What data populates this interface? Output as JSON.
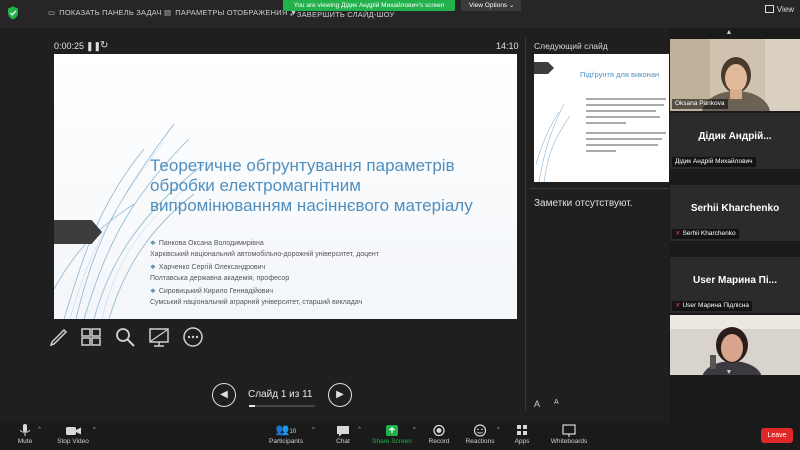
{
  "top_bar": {
    "taskbar_label": "ПОКАЗАТЬ ПАНЕЛЬ ЗАДАЧ",
    "display_settings_label": "ПАРАМЕТРЫ ОТОБРАЖЕНИЯ ▼",
    "end_show_label": "ЗАВЕРШИТЬ СЛАЙД-ШОУ",
    "viewing_banner": "You are viewing Дідик Андрій Михайлович's screen",
    "view_options_label": "View Options ⌄",
    "view_label": "View"
  },
  "presenter": {
    "elapsed": "0:00:25",
    "clock": "14:10",
    "slide_counter": "Слайд 1 из 11",
    "slide_index": 1,
    "slide_total": 11
  },
  "slide": {
    "title": "Теоретичне обгрунтування параметрів обробки електромагнітним випромінюванням насіннєвого матеріалу",
    "lines": [
      "Панкова Оксана Володимирівна",
      "Харківський національний автомобільно-дорожній університет, доцент",
      "Харченко Сергій Олександрович",
      "Полтавська державна академія, професор",
      "Сировицький Кирило Геннадійович",
      "Сумський національний аграрний університет, старший викладач"
    ],
    "bullet_rows": [
      0,
      2,
      4
    ]
  },
  "next_slide": {
    "label": "Следующий слайд",
    "title": "Підґрунтя для виконан"
  },
  "notes": {
    "text": "Заметки отсутствуют.",
    "font_large": "A",
    "font_small": "A"
  },
  "participants": [
    {
      "label": "Oksana Pankova",
      "big_name": "",
      "video": true,
      "muted": false
    },
    {
      "label": "Дідик Андрій Михайлович",
      "big_name": "Дідик Андрій...",
      "video": false,
      "muted": false
    },
    {
      "label": "Serhii Kharchenko",
      "big_name": "Serhii Kharchenko",
      "video": false,
      "muted": true
    },
    {
      "label": "User Марина Підлісна",
      "big_name": "User Марина Пі...",
      "video": false,
      "muted": true
    },
    {
      "label": "",
      "big_name": "",
      "video": true,
      "muted": false
    }
  ],
  "toolbar": {
    "mute": "Mute",
    "stop_video": "Stop Video",
    "participants": "Participants",
    "participants_count": "10",
    "chat": "Chat",
    "share_screen": "Share Screen",
    "record": "Record",
    "reactions": "Reactions",
    "apps": "Apps",
    "whiteboards": "Whiteboards",
    "leave": "Leave"
  },
  "colors": {
    "share_green": "#22b14c",
    "leave_red": "#e02828",
    "slide_title_blue": "#4f8fc0"
  }
}
